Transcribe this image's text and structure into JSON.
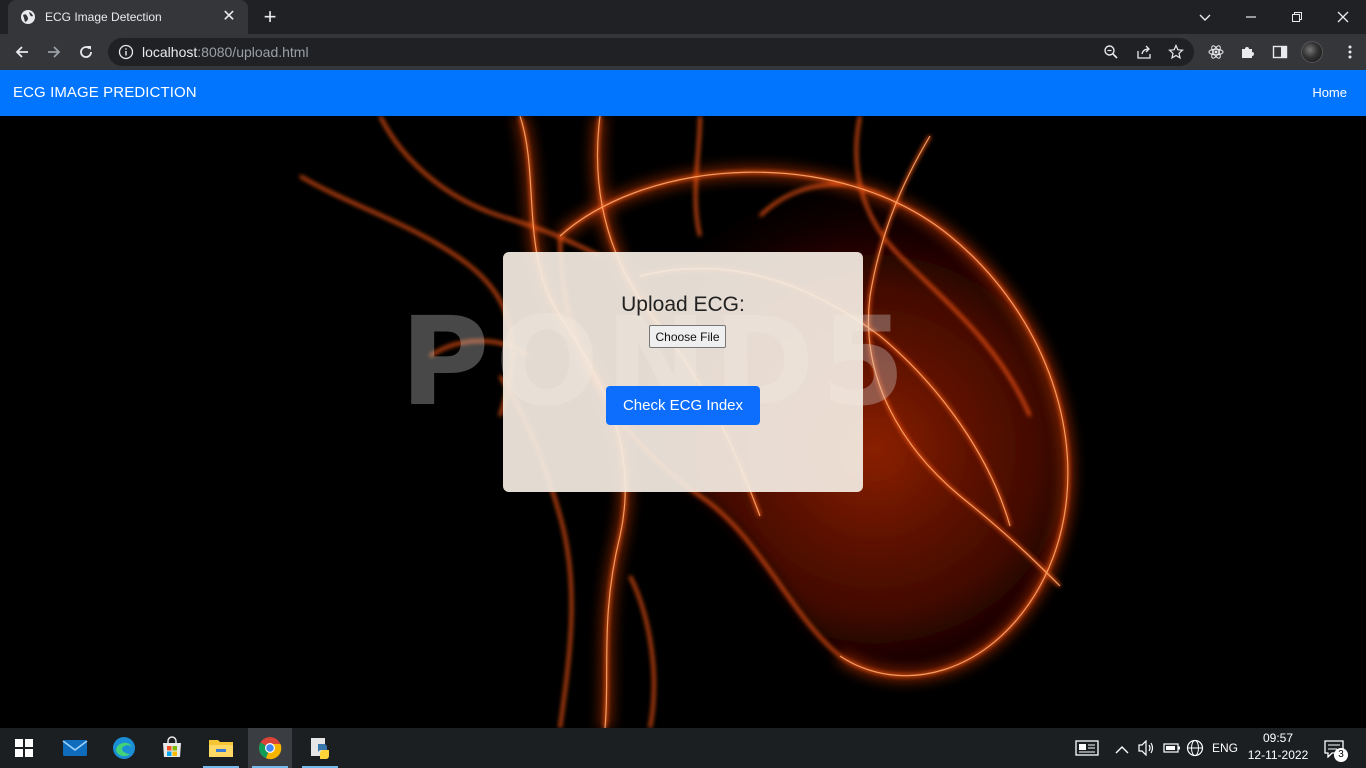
{
  "browser": {
    "tab_title": "ECG Image Detection",
    "url_host": "localhost",
    "url_rest": ":8080/upload.html"
  },
  "navbar": {
    "brand": "ECG IMAGE PREDICTION",
    "home_link": "Home",
    "color": "#0275ff"
  },
  "hero": {
    "watermark": "POND5"
  },
  "upload_form": {
    "title": "Upload ECG:",
    "file_button": "Choose File",
    "submit_button": "Check ECG Index",
    "submit_color": "#0d6efd"
  },
  "taskbar": {
    "apps": [
      "start-icon",
      "mail-icon",
      "edge-icon",
      "store-icon",
      "file-explorer-icon",
      "chrome-icon",
      "python-icon"
    ],
    "language": "ENG",
    "time": "09:57",
    "date": "12-11-2022",
    "notification_count": "3"
  }
}
